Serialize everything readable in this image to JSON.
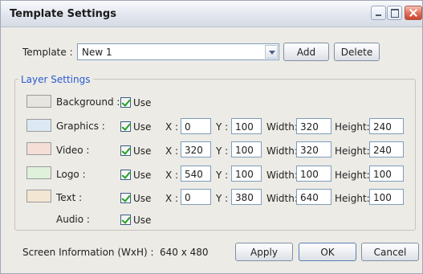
{
  "window": {
    "title": "Template Settings",
    "controls": [
      "minimize-icon",
      "maximize-icon",
      "close-icon"
    ]
  },
  "template": {
    "label": "Template :",
    "selected": "New 1",
    "add_label": "Add",
    "delete_label": "Delete"
  },
  "layer_settings": {
    "legend": "Layer Settings",
    "use_label": "Use",
    "layers": [
      {
        "name": "Background :",
        "use": true,
        "color": "#e6e5e0"
      },
      {
        "name": "Graphics :",
        "use": true,
        "color": "#dce9f4",
        "x": "0",
        "y": "100",
        "width": "320",
        "height": "240"
      },
      {
        "name": "Video :",
        "use": true,
        "color": "#f4ded6",
        "x": "320",
        "y": "100",
        "width": "320",
        "height": "240"
      },
      {
        "name": "Logo :",
        "use": true,
        "color": "#dff1da",
        "x": "540",
        "y": "100",
        "width": "100",
        "height": "100"
      },
      {
        "name": "Text :",
        "use": true,
        "color": "#f3e6d3",
        "x": "0",
        "y": "380",
        "width": "640",
        "height": "100"
      },
      {
        "name": "Audio :",
        "use": true
      }
    ],
    "field_labels": {
      "x": "X :",
      "y": "Y :",
      "width": "Width:",
      "height": "Height:"
    }
  },
  "screen_info": {
    "label": "Screen Information (WxH) :",
    "value": "640 x 480"
  },
  "footer": {
    "apply_label": "Apply",
    "ok_label": "OK",
    "cancel_label": "Cancel"
  },
  "colors": {
    "legend": "#2a5bd0",
    "check": "#21a121",
    "dialog_bg": "#ecebe6"
  }
}
